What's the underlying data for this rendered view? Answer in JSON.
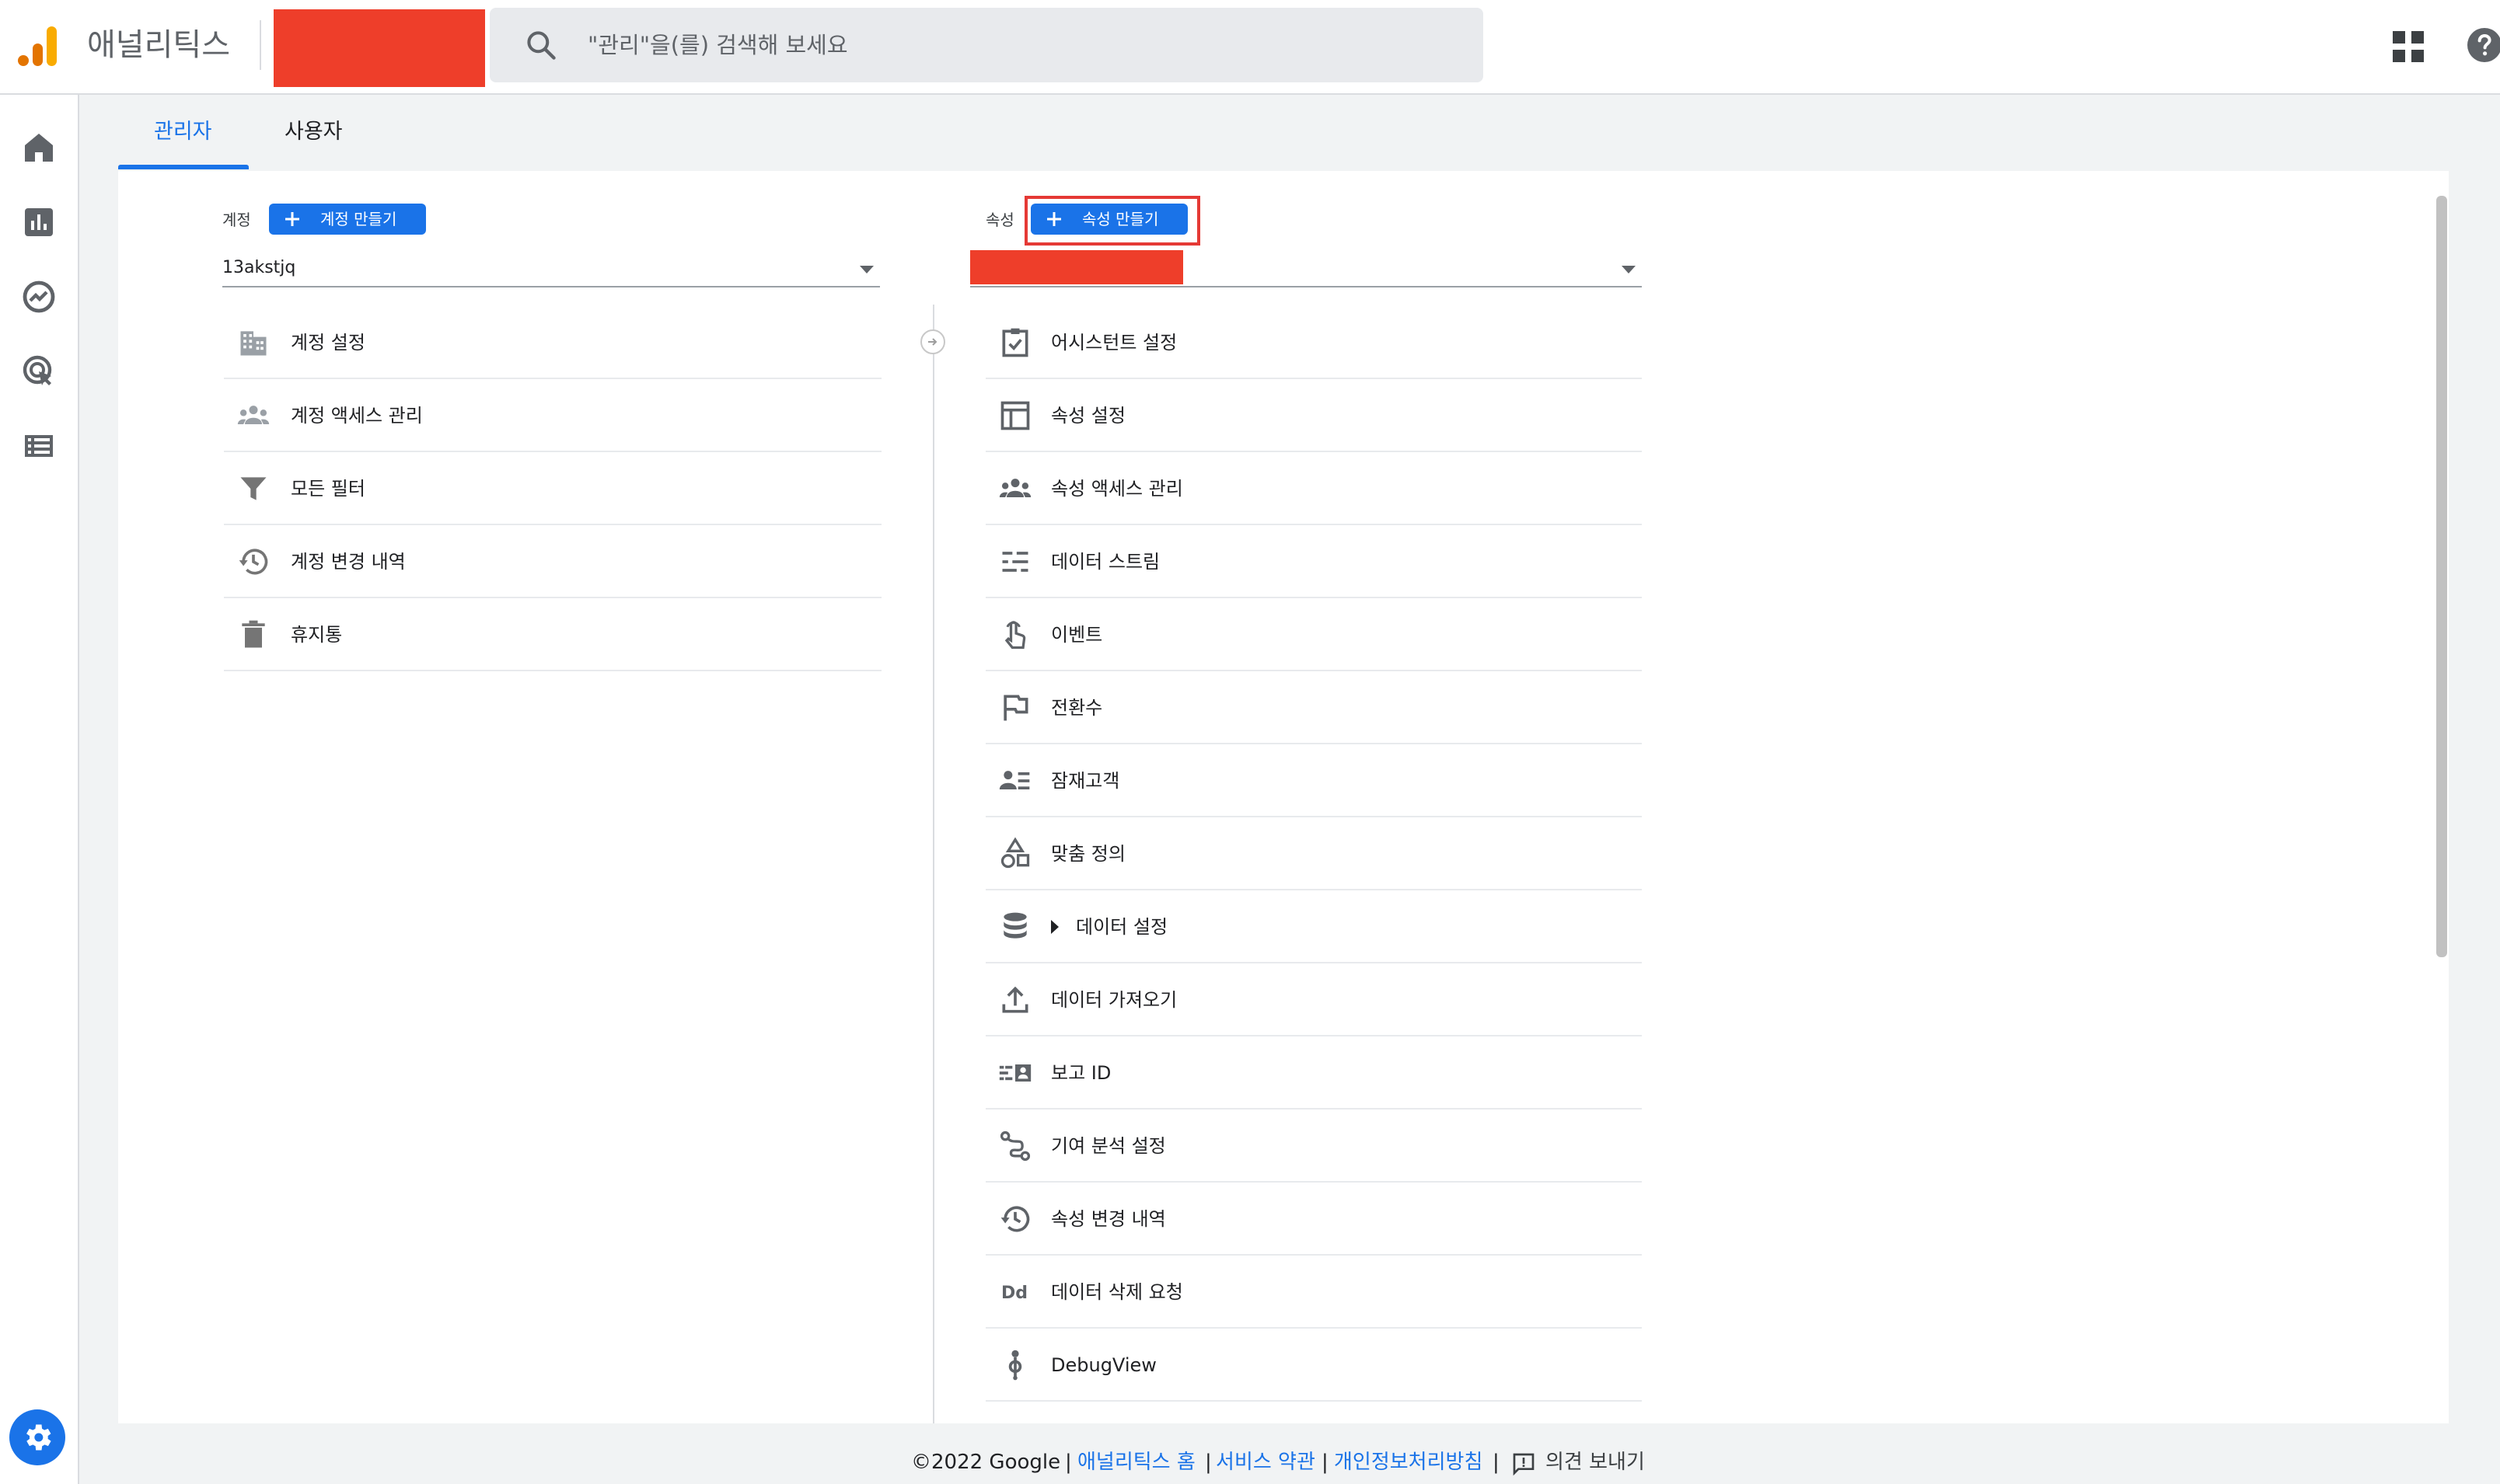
{
  "header": {
    "app_title": "애널리틱스",
    "search_placeholder": "\"관리\"을(를) 검색해 보세요",
    "apps_icon": "apps-grid-icon",
    "help_icon": "help-icon"
  },
  "left_nav": {
    "items": [
      {
        "icon": "home-icon"
      },
      {
        "icon": "reports-icon"
      },
      {
        "icon": "explore-icon"
      },
      {
        "icon": "advertising-icon"
      },
      {
        "icon": "configure-icon"
      }
    ],
    "settings_icon": "gear-icon"
  },
  "tabs": [
    {
      "label": "관리자",
      "active": true
    },
    {
      "label": "사용자",
      "active": false
    }
  ],
  "account": {
    "label": "계정",
    "create_label": "계정 만들기",
    "selected": "13akstjq",
    "items": [
      {
        "label": "계정 설정",
        "icon": "building-icon"
      },
      {
        "label": "계정 액세스 관리",
        "icon": "people-icon"
      },
      {
        "label": "모든 필터",
        "icon": "filter-icon"
      },
      {
        "label": "계정 변경 내역",
        "icon": "history-icon"
      },
      {
        "label": "휴지통",
        "icon": "trash-icon"
      }
    ]
  },
  "property": {
    "label": "속성",
    "create_label": "속성 만들기",
    "items": [
      {
        "label": "어시스턴트 설정",
        "icon": "checklist-icon"
      },
      {
        "label": "속성 설정",
        "icon": "layout-icon"
      },
      {
        "label": "속성 액세스 관리",
        "icon": "people-icon"
      },
      {
        "label": "데이터 스트림",
        "icon": "streams-icon"
      },
      {
        "label": "이벤트",
        "icon": "touch-icon"
      },
      {
        "label": "전환수",
        "icon": "flag-icon"
      },
      {
        "label": "잠재고객",
        "icon": "audience-icon"
      },
      {
        "label": "맞춤 정의",
        "icon": "shapes-icon"
      },
      {
        "label": "데이터 설정",
        "icon": "database-icon",
        "expandable": true
      },
      {
        "label": "데이터 가져오기",
        "icon": "upload-icon"
      },
      {
        "label": "보고 ID",
        "icon": "id-icon"
      },
      {
        "label": "기여 분석 설정",
        "icon": "attribution-icon"
      },
      {
        "label": "속성 변경 내역",
        "icon": "history-icon"
      },
      {
        "label": "데이터 삭제 요청",
        "icon": "dd-icon"
      },
      {
        "label": "DebugView",
        "icon": "debug-icon"
      }
    ]
  },
  "footer": {
    "copyright": "©2022 Google",
    "sep1": "|",
    "link_home": "애널리틱스 홈",
    "sep2": "|",
    "link_terms": "서비스 약관",
    "sep3": "|",
    "link_privacy": "개인정보처리방침",
    "sep4": "|",
    "feedback": "의견 보내기"
  },
  "colors": {
    "accent": "#1a73e8",
    "redaction": "#ee3e2a",
    "highlight": "#e53935",
    "logo_orange": "#f9ab00",
    "logo_dark": "#e37400"
  }
}
